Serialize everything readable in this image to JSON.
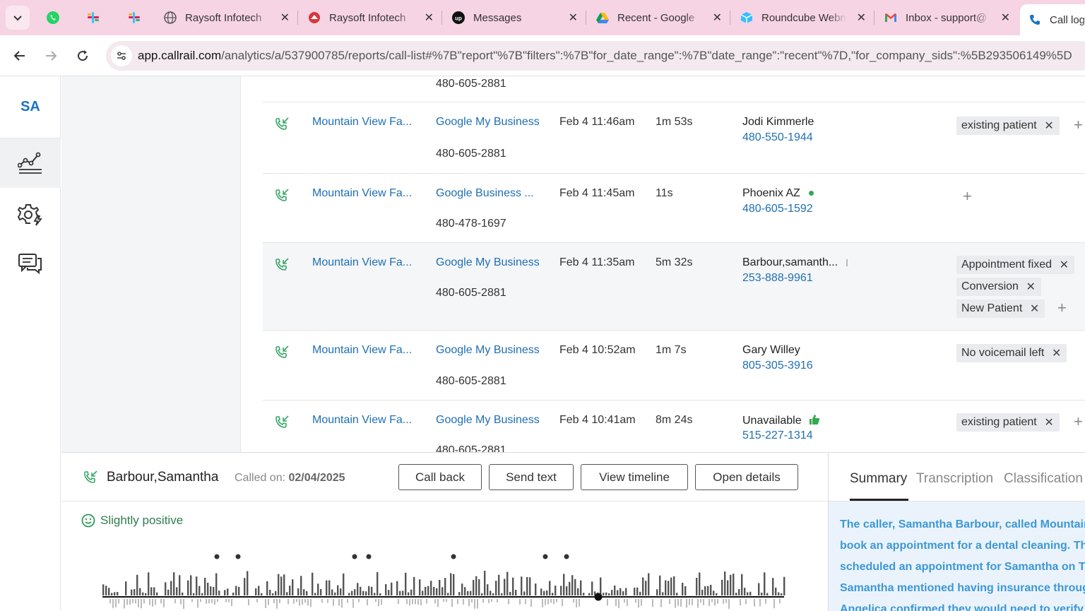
{
  "browser": {
    "tabs": [
      {
        "title": "Raysoft Infotech",
        "icon": "globe-icon"
      },
      {
        "title": "Raysoft Infotech",
        "icon": "raysoft-icon"
      },
      {
        "title": "Messages",
        "icon": "upwork-icon"
      },
      {
        "title": "Recent - Google",
        "icon": "google-drive-icon"
      },
      {
        "title": "Roundcube Webm",
        "icon": "roundcube-icon"
      },
      {
        "title": "Inbox - support@",
        "icon": "gmail-icon"
      },
      {
        "title": "Call log",
        "icon": "phone-icon"
      }
    ],
    "url_host": "app.callrail.com",
    "url_path": "/analytics/a/537900785/reports/call-list#%7B\"report\"%7B\"filters\":%7B\"for_date_range\":%7B\"date_range\":\"recent\"%7D,\"for_company_sids\":%5B293506149%5D"
  },
  "nav": {
    "logo": "SA"
  },
  "calls": [
    {
      "number": "480-605-2881"
    },
    {
      "company": "Mountain View Fa...",
      "source": "Google My Business",
      "number": "480-605-2881",
      "date": "Feb 4 11:46am",
      "duration": "1m 53s",
      "caller": "Jodi Kimmerle",
      "phone": "480-550-1944",
      "tags": [
        "existing patient"
      ]
    },
    {
      "company": "Mountain View Fa...",
      "source": "Google Business ...",
      "number": "480-478-1697",
      "date": "Feb 4 11:45am",
      "duration": "11s",
      "caller": "Phoenix AZ",
      "phone": "480-605-1592",
      "tags": []
    },
    {
      "company": "Mountain View Fa...",
      "source": "Google My Business",
      "number": "480-605-2881",
      "date": "Feb 4 11:35am",
      "duration": "5m 32s",
      "caller": "Barbour,samanth...",
      "phone": "253-888-9961",
      "tags": [
        "Appointment fixed",
        "Conversion",
        "New Patient"
      ]
    },
    {
      "company": "Mountain View Fa...",
      "source": "Google My Business",
      "number": "480-605-2881",
      "date": "Feb 4 10:52am",
      "duration": "1m 7s",
      "caller": "Gary Willey",
      "phone": "805-305-3916",
      "tags": [
        "No voicemail left"
      ]
    },
    {
      "company": "Mountain View Fa...",
      "source": "Google My Business",
      "number": "480-605-2881",
      "date": "Feb 4 10:41am",
      "duration": "8m 24s",
      "caller": "Unavailable",
      "phone": "515-227-1314",
      "tags": [
        "existing patient"
      ]
    }
  ],
  "detail": {
    "caller": "Barbour,Samantha",
    "called_on_label": "Called on:",
    "called_on_date": "02/04/2025",
    "buttons": {
      "call_back": "Call back",
      "send_text": "Send text",
      "view_timeline": "View timeline",
      "open_details": "Open details"
    },
    "sentiment": "Slightly positive",
    "tabs": {
      "summary": "Summary",
      "transcription": "Transcription",
      "classification": "Classification"
    },
    "summary_text": "The caller, Samantha Barbour, called Mountain View Family Dentistry to book an appointment for a dental cleaning. The receptionist, Angelica, scheduled an appointment for Samantha on Tuesday, February 11th. Samantha mentioned having insurance through Delta Dental, and Angelica confirmed they would need to verify the coverage. Samantha will be receiving a confirmation text."
  },
  "colors": {
    "link": "#1f6fb4",
    "accent_green": "#34a853",
    "summary_text": "#3d97d6"
  }
}
